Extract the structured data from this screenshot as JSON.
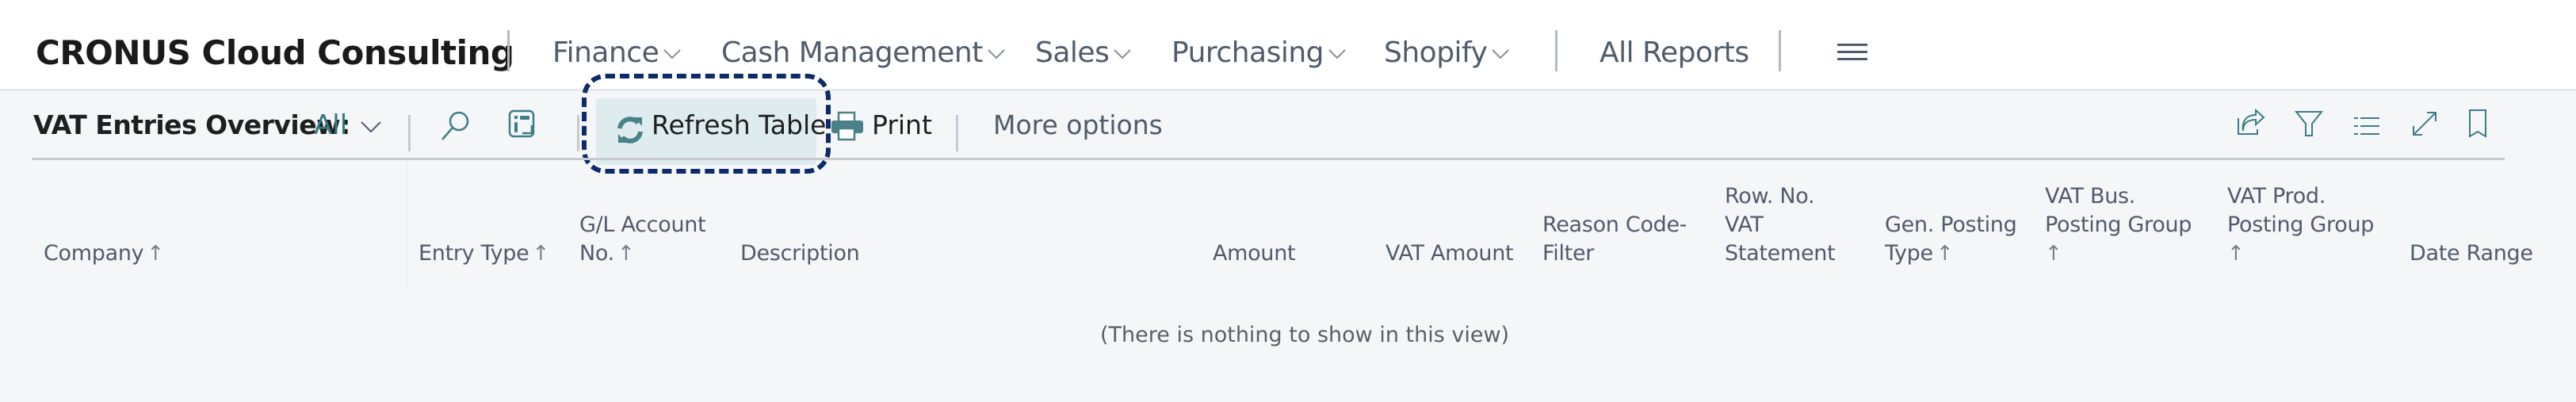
{
  "app": {
    "company_name": "CRONUS Cloud Consulting"
  },
  "nav": {
    "items": [
      {
        "label": "Finance",
        "has_dropdown": true
      },
      {
        "label": "Cash Management",
        "has_dropdown": true
      },
      {
        "label": "Sales",
        "has_dropdown": true
      },
      {
        "label": "Purchasing",
        "has_dropdown": true
      },
      {
        "label": "Shopify",
        "has_dropdown": true
      }
    ],
    "all_reports": "All Reports",
    "menu_icon": "hamburger-icon"
  },
  "actionbar": {
    "page_caption": "VAT Entries Overview:",
    "view_filter": "All",
    "search_icon": "search-icon",
    "layout_icon": "edit-layout-icon",
    "refresh_label": "Refresh Table",
    "refresh_icon": "refresh-icon",
    "print_label": "Print",
    "print_icon": "printer-icon",
    "more_options": "More options",
    "right_icons": [
      "share-icon",
      "filter-icon",
      "list-view-icon",
      "expand-icon",
      "bookmark-icon"
    ],
    "accent_color": "#367a84",
    "focus_color": "#0d2a6b"
  },
  "table": {
    "columns": [
      {
        "lines": [
          "Company"
        ],
        "sorted": "asc"
      },
      {
        "lines": [
          "Entry Type"
        ],
        "sorted": "asc"
      },
      {
        "lines": [
          "G/L Account",
          "No."
        ],
        "sorted": "asc"
      },
      {
        "lines": [
          "Description"
        ],
        "sorted": null
      },
      {
        "lines": [
          "Amount"
        ],
        "sorted": null
      },
      {
        "lines": [
          "VAT Amount"
        ],
        "sorted": null
      },
      {
        "lines": [
          "Reason Code-",
          "Filter"
        ],
        "sorted": null
      },
      {
        "lines": [
          "Row. No.",
          "VAT",
          "Statement"
        ],
        "sorted": null
      },
      {
        "lines": [
          "Gen. Posting",
          "Type"
        ],
        "sorted": "asc"
      },
      {
        "lines": [
          "VAT Bus.",
          "Posting Group",
          ""
        ],
        "sorted": "asc"
      },
      {
        "lines": [
          "VAT Prod.",
          "Posting Group",
          ""
        ],
        "sorted": "asc"
      },
      {
        "lines": [
          "Date Range"
        ],
        "sorted": null
      }
    ],
    "rows": [],
    "empty_message": "(There is nothing to show in this view)"
  }
}
